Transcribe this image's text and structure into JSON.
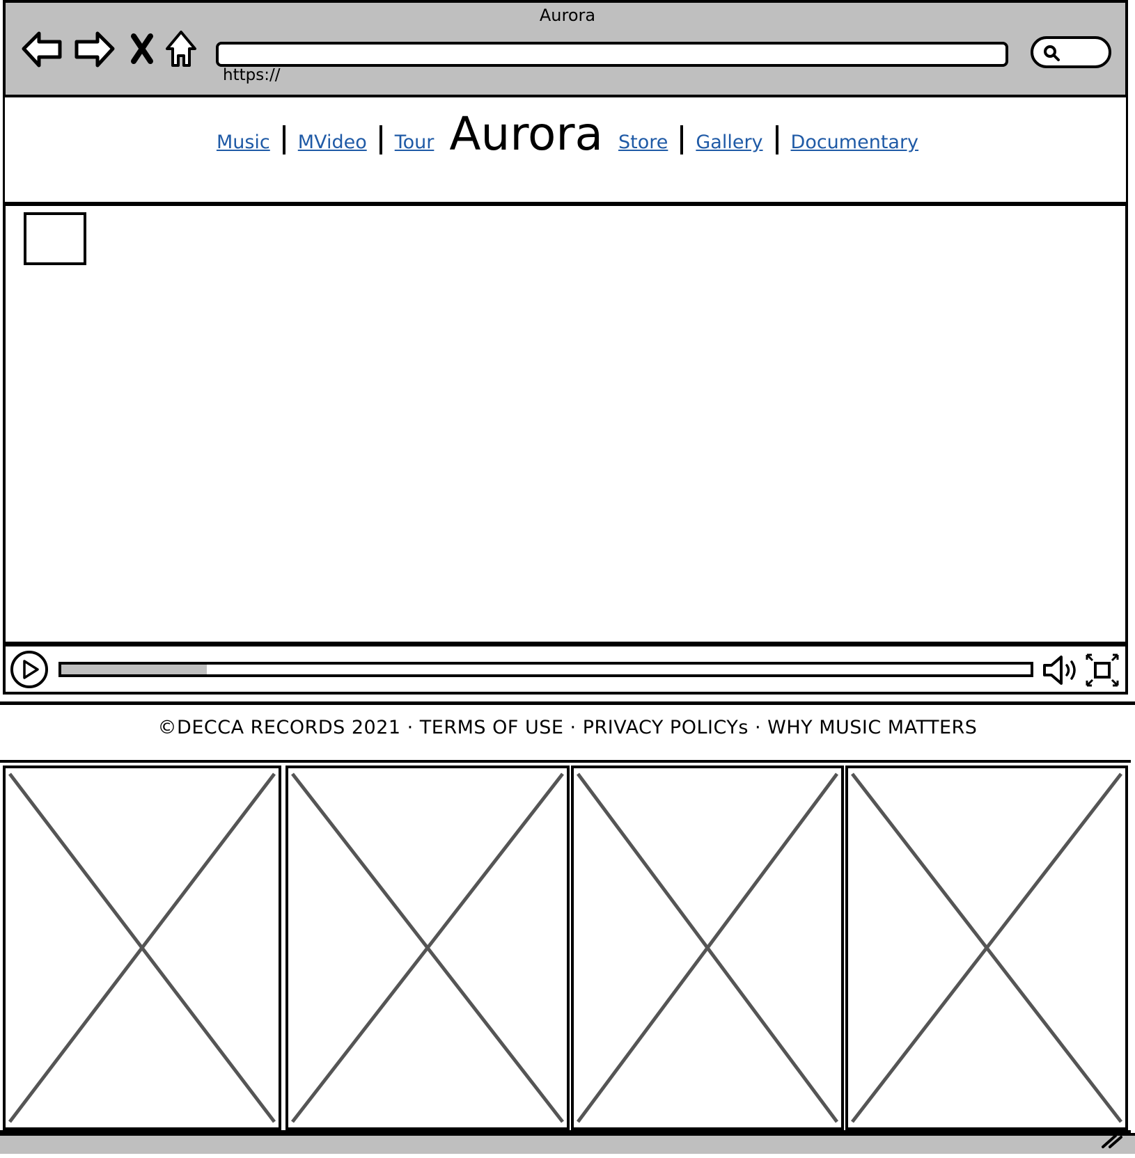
{
  "window": {
    "title": "Aurora",
    "url_placeholder": "https://"
  },
  "toolbar_icons": [
    "back-arrow-icon",
    "forward-arrow-icon",
    "close-icon",
    "home-icon",
    "search-icon"
  ],
  "site": {
    "brand": "Aurora",
    "nav_left": [
      {
        "label": "Music"
      },
      {
        "label": "MVideo"
      },
      {
        "label": "Tour"
      }
    ],
    "nav_right": [
      {
        "label": "Store"
      },
      {
        "label": "Gallery"
      },
      {
        "label": "Documentary"
      }
    ],
    "link_color": "#1f5aa6"
  },
  "video_player": {
    "progress_fraction": 0.15,
    "icons": [
      "play-icon",
      "volume-icon",
      "fullscreen-icon"
    ]
  },
  "footer": {
    "text": "©DECCA RECORDS 2021 · TERMS OF USE · PRIVACY POLICYs · WHY MUSIC MATTERS"
  },
  "gallery": {
    "item_count": 4
  },
  "colors": {
    "chrome": "#bfbfbf",
    "placeholder_lines": "#555555"
  }
}
